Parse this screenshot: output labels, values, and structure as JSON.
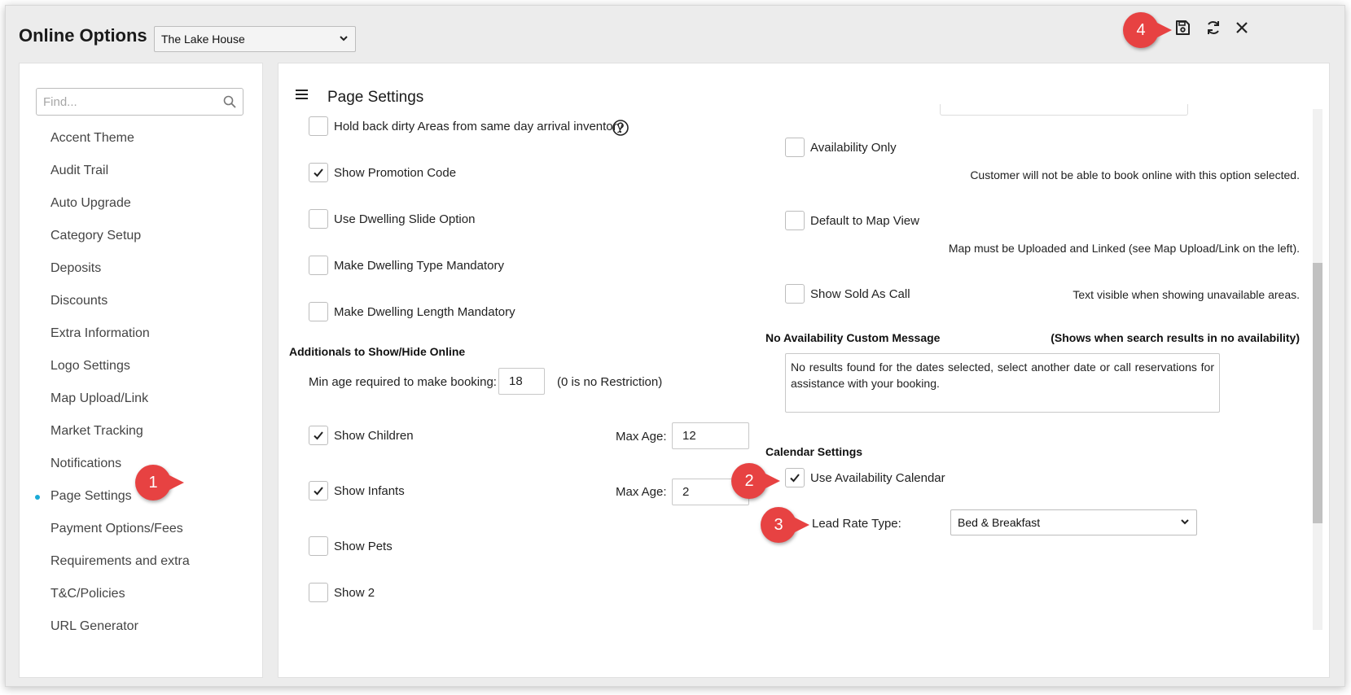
{
  "header": {
    "title": "Online Options",
    "property_select": "The Lake House"
  },
  "toolbar": {
    "save_icon": "save-icon",
    "refresh_icon": "refresh-icon",
    "close_icon": "close-icon"
  },
  "callouts": [
    "1",
    "2",
    "3",
    "4"
  ],
  "sidebar": {
    "search_placeholder": "Find...",
    "items": [
      {
        "label": "Accent Theme"
      },
      {
        "label": "Audit Trail"
      },
      {
        "label": "Auto Upgrade"
      },
      {
        "label": "Category Setup"
      },
      {
        "label": "Deposits"
      },
      {
        "label": "Discounts"
      },
      {
        "label": "Extra Information"
      },
      {
        "label": "Logo Settings"
      },
      {
        "label": "Map Upload/Link"
      },
      {
        "label": "Market Tracking"
      },
      {
        "label": "Notifications"
      },
      {
        "label": "Page Settings",
        "active": true
      },
      {
        "label": "Payment Options/Fees"
      },
      {
        "label": "Requirements and extra"
      },
      {
        "label": "T&C/Policies"
      },
      {
        "label": "URL Generator"
      }
    ]
  },
  "main": {
    "title": "Page Settings",
    "left_options": [
      {
        "label": "Hold back dirty Areas from same day arrival inventory",
        "checked": false
      },
      {
        "label": "Show Promotion Code",
        "checked": true
      },
      {
        "label": "Use Dwelling Slide Option",
        "checked": false
      },
      {
        "label": "Make Dwelling Type Mandatory",
        "checked": false
      },
      {
        "label": "Make Dwelling Length Mandatory",
        "checked": false
      }
    ],
    "additionals": {
      "heading": "Additionals to Show/Hide Online",
      "min_age_label": "Min age required to make booking:",
      "min_age_value": "18",
      "min_age_note": "(0 is no Restriction)",
      "show_children": {
        "label": "Show Children",
        "checked": true,
        "max_age_label": "Max Age:",
        "max_age_value": "12"
      },
      "show_infants": {
        "label": "Show Infants",
        "checked": true,
        "max_age_label": "Max Age:",
        "max_age_value": "2"
      },
      "show_pets": {
        "label": "Show Pets",
        "checked": false
      },
      "show_2": {
        "label": "Show 2",
        "checked": false
      }
    },
    "right": {
      "availability_only": {
        "label": "Availability Only",
        "checked": false,
        "note": "Customer will not be able to book online with this option selected."
      },
      "default_map_view": {
        "label": "Default to Map View",
        "checked": false,
        "note": "Map must be Uploaded and Linked (see Map Upload/Link on the left)."
      },
      "show_sold_as_call": {
        "label": "Show Sold As Call",
        "checked": false,
        "note": "Text visible when showing unavailable areas."
      },
      "no_availability": {
        "heading": "No Availability Custom Message",
        "hint": "(Shows when search results in no availability)",
        "message": "No results found for the dates selected, select another date or call reservations for assistance with your booking."
      },
      "calendar": {
        "heading": "Calendar Settings",
        "use_availability_calendar": {
          "label": "Use Availability Calendar",
          "checked": true
        },
        "lead_rate_label": "Lead Rate Type:",
        "lead_rate_value": "Bed & Breakfast"
      }
    }
  }
}
